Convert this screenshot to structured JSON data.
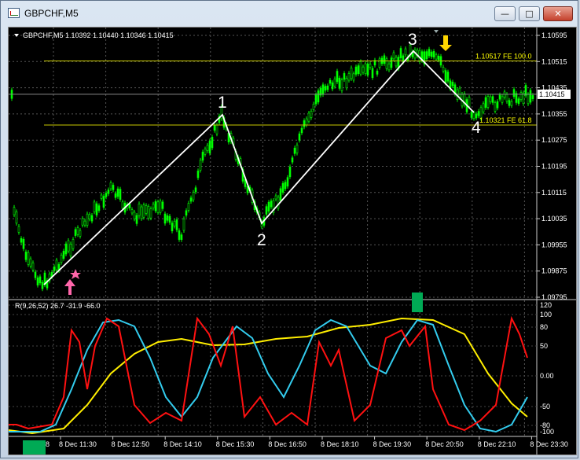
{
  "window": {
    "title": "GBPCHF,M5",
    "minimize_label": "—",
    "maximize_label": "□",
    "close_label": "✕"
  },
  "main_chart": {
    "header": "GBPCHF,M5  1.10392 1.10440 1.10346 1.10415",
    "collapse_arrow_icon": "triangle-down-icon",
    "price_levels": [
      "1.10595",
      "1.10515",
      "1.10435",
      "1.10355",
      "1.10275",
      "1.10195",
      "1.10115",
      "1.10035",
      "1.09955",
      "1.09875",
      "1.09795"
    ],
    "current_price": "1.10415",
    "fe_labels": [
      {
        "text": "1.10517 FE 100.0",
        "price": 1.10517
      },
      {
        "text": "1.10321 FE 61.8",
        "price": 1.10321
      }
    ],
    "wave_labels": [
      "1",
      "2",
      "3",
      "4"
    ],
    "colors": {
      "candles": "#00ff00",
      "wave_lines": "#ffffff",
      "fe_lines": "#c8c800",
      "fe_text": "#ffff00",
      "buy_arrow": "#ff66aa",
      "sell_arrow": "#ffd700",
      "background": "#000000"
    }
  },
  "sub_chart": {
    "header": "R(9,26,52) 26.7 -31.9 -66.0",
    "levels": [
      "120",
      "100",
      "80",
      "50",
      "0.00",
      "-50",
      "-80",
      "-100"
    ],
    "colors": {
      "fast": "#ff1111",
      "medium": "#33ccee",
      "slow": "#ffee00",
      "marker": "#00aa55"
    }
  },
  "time_axis": [
    "8 Dec 11:30",
    "8 Dec 12:50",
    "8 Dec 14:10",
    "8 Dec 15:30",
    "8 Dec 16:50",
    "8 Dec 18:10",
    "8 Dec 19:30",
    "8 Dec 20:50",
    "8 Dec 22:10",
    "8 Dec 23:30"
  ],
  "time_axis_first": "8"
}
